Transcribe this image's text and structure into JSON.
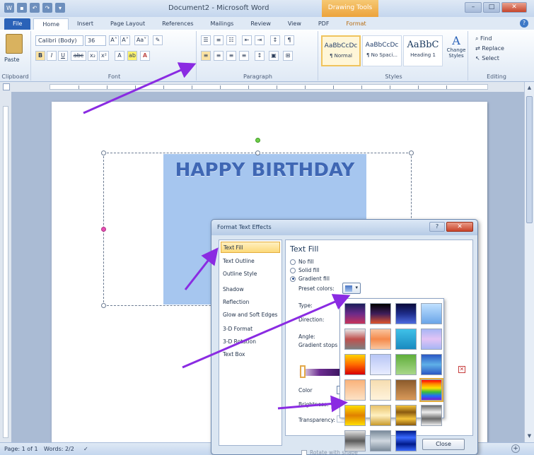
{
  "window": {
    "title": "Document2 - Microsoft Word",
    "contextual_band": "Drawing Tools"
  },
  "tabs": [
    {
      "label": "File"
    },
    {
      "label": "Home"
    },
    {
      "label": "Insert"
    },
    {
      "label": "Page Layout"
    },
    {
      "label": "References"
    },
    {
      "label": "Mailings"
    },
    {
      "label": "Review"
    },
    {
      "label": "View"
    },
    {
      "label": "PDF"
    },
    {
      "label": "Format"
    }
  ],
  "ribbon": {
    "clipboard": {
      "label": "Clipboard",
      "paste": "Paste"
    },
    "font": {
      "label": "Font",
      "name": "Calibri (Body)",
      "size": "36",
      "grow": "A˄",
      "shrink": "A˅",
      "case": "Aa˅",
      "bold": "B",
      "italic": "I",
      "underline": "U",
      "strike": "abc",
      "sub": "x₂",
      "sup": "x²",
      "font_color": "A"
    },
    "paragraph": {
      "label": "Paragraph",
      "pilcrow": "¶"
    },
    "styles": {
      "label": "Styles",
      "items": [
        {
          "sample": "AaBbCcDc",
          "name": "¶ Normal"
        },
        {
          "sample": "AaBbCcDc",
          "name": "¶ No Spaci..."
        },
        {
          "sample": "AaBbC",
          "name": "Heading 1"
        }
      ],
      "change": "Change Styles"
    },
    "editing": {
      "label": "Editing",
      "find": "Find",
      "replace": "Replace",
      "select": "Select"
    }
  },
  "document": {
    "wordart_text": "HAPPY BIRTHDAY"
  },
  "status": {
    "page": "Page: 1 of 1",
    "words": "Words: 2/2"
  },
  "dialog": {
    "title": "Format Text Effects",
    "categories": [
      "Text Fill",
      "Text Outline",
      "Outline Style",
      "Shadow",
      "Reflection",
      "Glow and Soft Edges",
      "3-D Format",
      "3-D Rotation",
      "Text Box"
    ],
    "selected_category": "Text Fill",
    "section_title": "Text Fill",
    "fill_options": [
      "No fill",
      "Solid fill",
      "Gradient fill"
    ],
    "selected_fill": "Gradient fill",
    "labels": {
      "preset": "Preset colors:",
      "type": "Type:",
      "direction": "Direction:",
      "angle": "Angle:",
      "stops": "Gradient stops",
      "color": "Color",
      "brightness": "Brightness:",
      "transparency": "Transparency:"
    },
    "rotate": "Rotate with shape",
    "close": "Close"
  },
  "palette": {
    "swatches": [
      "linear-gradient(#1b1e5a,#6b2a8a,#c8345a)",
      "linear-gradient(#000000,#3d1d5a,#e0552c)",
      "linear-gradient(#0a0a3a,#1f2d8a,#4c6ae0)",
      "linear-gradient(#bfe0ff,#6aa5e8)",
      "linear-gradient(#e6e6e6,#c0504d,#7f7f7f)",
      "linear-gradient(#f9c6a0,#f58a4b,#f9c6a0)",
      "linear-gradient(#3fc1e8,#1a8ac0)",
      "linear-gradient(#a7b6f5,#e2c3f5,#a7b6f5)",
      "linear-gradient(#ffd400,#ff6a00,#d80000)",
      "linear-gradient(#b8c6f5,#e8ecff)",
      "linear-gradient(#5fae3a,#a9d78a)",
      "linear-gradient(#2a57c4,#5fb0e8,#2a57c4)",
      "linear-gradient(#f9b27a,#fde2c6)",
      "linear-gradient(#f6ddb0,#fff3dc)",
      "linear-gradient(#8b5a2b,#d99a5a)",
      "linear-gradient(#ff0000,#ff8c00,#ffe000,#3cbd3c,#1e6cff,#7a1ec8)",
      "linear-gradient(#ffde00,#e08000,#ffde00)",
      "linear-gradient(#e8c26a,#fff0c0,#c99a2a)",
      "linear-gradient(#f5c43a,#8a5a10,#f5c43a,#8a5a10)",
      "linear-gradient(#6a6a6a,#eeeeee,#6a6a6a,#eeeeee)",
      "linear-gradient(#e0e0e0,#5a5a5a,#e0e0e0)",
      "linear-gradient(#7a8a9a,#d0d8e0,#7a8a9a)",
      "linear-gradient(#001a8a,#3a6aff,#001a8a,#3a6aff)"
    ]
  },
  "colors": {
    "accent": "#2a62b8",
    "wordart": "#3f67b4",
    "textbox_fill": "#a6c6ef",
    "annotation_arrow": "#8a2be2"
  }
}
